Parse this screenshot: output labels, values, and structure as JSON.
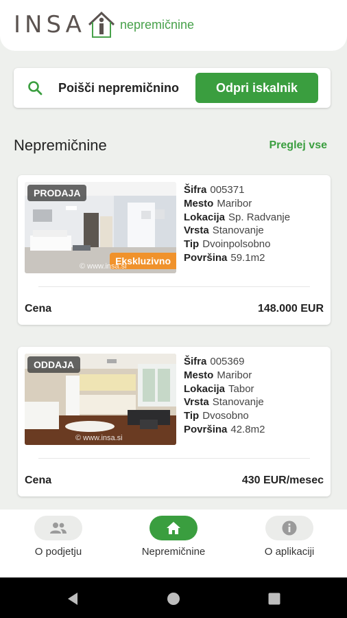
{
  "header": {
    "brand": "INSA",
    "brand_sub": "nepremičnine"
  },
  "search": {
    "label": "Poišči nepremičnino",
    "button": "Odpri iskalnik"
  },
  "section": {
    "title": "Nepremičnine",
    "link": "Preglej vse"
  },
  "listings": [
    {
      "type_badge": "PRODAJA",
      "exclusive_badge": "Ekskluzivno",
      "watermark": "© www.insa.si",
      "props": [
        {
          "k": "Šifra",
          "v": "005371"
        },
        {
          "k": "Mesto",
          "v": "Maribor"
        },
        {
          "k": "Lokacija",
          "v": "Sp. Radvanje"
        },
        {
          "k": "Vrsta",
          "v": "Stanovanje"
        },
        {
          "k": "Tip",
          "v": "Dvoinpolsobno"
        },
        {
          "k": "Površina",
          "v": "59.1m2"
        }
      ],
      "price_label": "Cena",
      "price": "148.000 EUR"
    },
    {
      "type_badge": "ODDAJA",
      "watermark": "© www.insa.si",
      "props": [
        {
          "k": "Šifra",
          "v": "005369"
        },
        {
          "k": "Mesto",
          "v": "Maribor"
        },
        {
          "k": "Lokacija",
          "v": "Tabor"
        },
        {
          "k": "Vrsta",
          "v": "Stanovanje"
        },
        {
          "k": "Tip",
          "v": "Dvosobno"
        },
        {
          "k": "Površina",
          "v": "42.8m2"
        }
      ],
      "price_label": "Cena",
      "price": "430 EUR/mesec"
    }
  ],
  "nav": [
    {
      "label": "O podjetju",
      "icon": "people-icon",
      "active": false
    },
    {
      "label": "Nepremičnine",
      "icon": "home-icon",
      "active": true
    },
    {
      "label": "O aplikaciji",
      "icon": "info-icon",
      "active": false
    }
  ],
  "colors": {
    "accent": "#3a9e3f",
    "exclusive": "#f0922c",
    "background": "#eef0ed"
  }
}
